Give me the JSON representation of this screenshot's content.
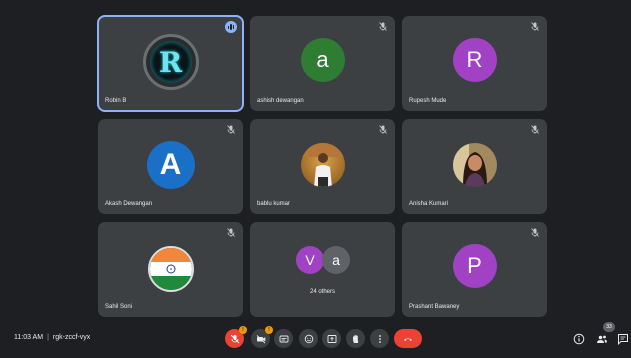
{
  "participants": [
    {
      "name": "Robin B",
      "kind": "robin",
      "avatar_letter": "R",
      "speaking": true
    },
    {
      "name": "ashish dewangan",
      "kind": "letter",
      "avatar_letter": "a",
      "color": "#2e7d32",
      "muted": true
    },
    {
      "name": "Rupesh Mude",
      "kind": "letter",
      "avatar_letter": "R",
      "color": "#a142c4",
      "muted": true
    },
    {
      "name": "Akash Dewangan",
      "kind": "akash",
      "avatar_letter": "A",
      "color": "#1a6fc7",
      "muted": true
    },
    {
      "name": "bablu kumar",
      "kind": "photo-man",
      "muted": true
    },
    {
      "name": "Anisha Kumari",
      "kind": "photo-woman",
      "muted": true
    },
    {
      "name": "Sahil Soni",
      "kind": "flag",
      "muted": true
    },
    {
      "kind": "others",
      "others_label": "24 others",
      "mini": [
        {
          "letter": "V",
          "color": "#a142c4"
        },
        {
          "letter": "a",
          "color": "#5f6368"
        }
      ]
    },
    {
      "name": "Prashant Bawaney",
      "kind": "letter",
      "avatar_letter": "P",
      "color": "#a142c4",
      "muted": true
    }
  ],
  "meeting": {
    "time": "11:03 AM",
    "separator": "|",
    "code": "rgk-zccf-vyx"
  },
  "controls": {
    "mic_badge": "!",
    "camera_badge": "!"
  },
  "side": {
    "participant_count": "33"
  },
  "colors": {
    "background": "#1e1f22",
    "tile": "#3c4043",
    "speaking_outline": "#8ab4f8",
    "end_call": "#ea4335"
  },
  "icons": [
    "mic-off-icon",
    "camera-off-icon",
    "captions-icon",
    "emoji-icon",
    "present-icon",
    "raise-hand-icon",
    "more-options-icon",
    "end-call-icon",
    "info-icon",
    "people-icon",
    "chat-icon"
  ]
}
